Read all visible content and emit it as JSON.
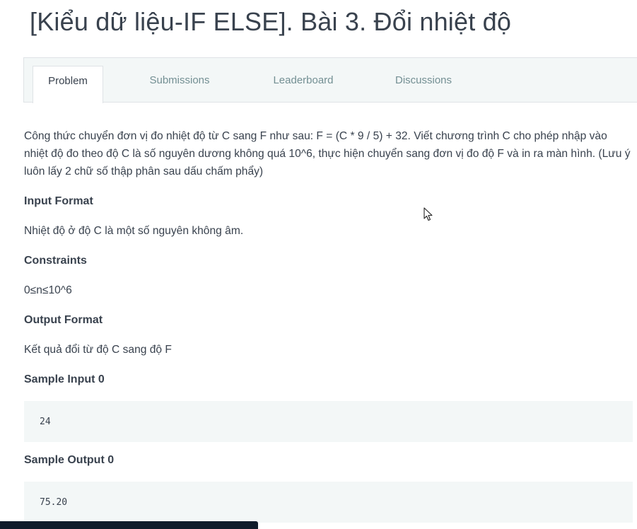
{
  "title": "[Kiểu dữ liệu-IF ELSE]. Bài 3. Đổi nhiệt độ",
  "tabs": [
    {
      "label": "Problem",
      "active": true
    },
    {
      "label": "Submissions",
      "active": false
    },
    {
      "label": "Leaderboard",
      "active": false
    },
    {
      "label": "Discussions",
      "active": false
    }
  ],
  "description": "Công thức chuyển đơn vị đo nhiệt độ từ C sang F như sau: F = (C * 9 / 5) + 32. Viết chương trình C cho phép nhập vào nhiệt độ đo theo độ C là số nguyên dương không quá 10^6, thực hiện chuyển sang đơn vị đo độ F và in ra màn hình. (Lưu ý luôn lấy 2 chữ số thập phân sau dấu chấm phẩy)",
  "sections": {
    "input_format": {
      "heading": "Input Format",
      "text": "Nhiệt độ ở độ C là một số nguyên không âm."
    },
    "constraints": {
      "heading": "Constraints",
      "text": "0≤n≤10^6"
    },
    "output_format": {
      "heading": "Output Format",
      "text": "Kết quả đổi từ độ C sang độ F"
    },
    "sample_input": {
      "heading": "Sample Input 0",
      "code": "24"
    },
    "sample_output": {
      "heading": "Sample Output 0",
      "code": "75.20"
    }
  },
  "colors": {
    "text": "#39424e",
    "tab_inactive": "#738f93",
    "panel_bg": "#f3f7f7",
    "border": "#dfe3e6"
  }
}
